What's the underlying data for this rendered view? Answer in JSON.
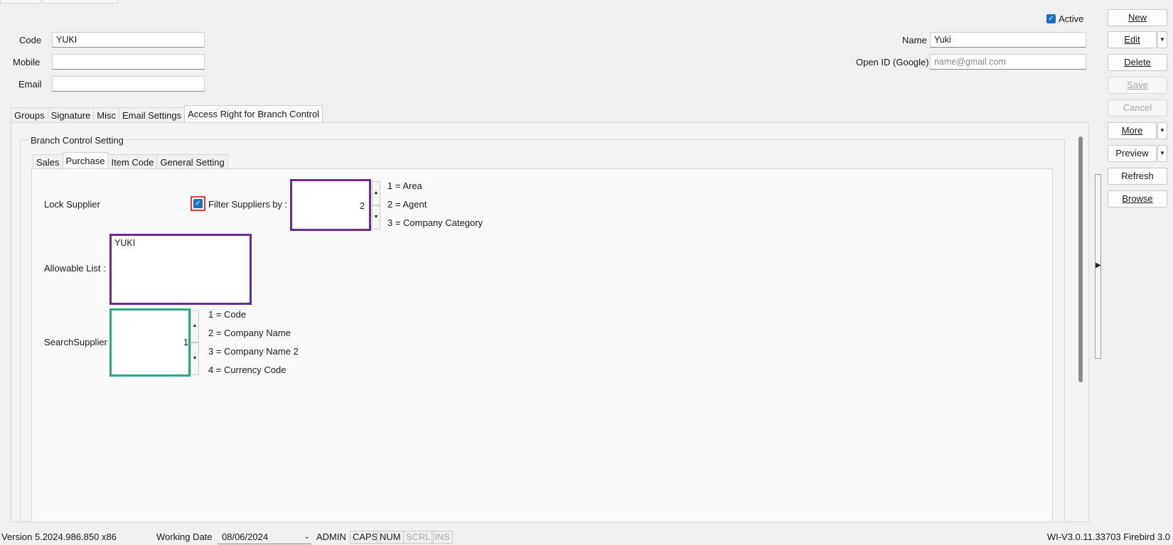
{
  "header": {
    "active_label": "Active",
    "code_label": "Code",
    "code_value": "YUKI",
    "mobile_label": "Mobile",
    "mobile_value": "",
    "email_label": "Email",
    "email_value": "",
    "name_label": "Name",
    "name_value": "Yuki",
    "openid_label": "Open ID (Google)",
    "openid_placeholder": "name@gmail.com"
  },
  "main_tabs": [
    "Groups",
    "Signature",
    "Misc",
    "Email Settings",
    "Access Right for Branch Control"
  ],
  "branch": {
    "group_title": "Branch Control Setting",
    "tabs": [
      "Sales",
      "Purchase",
      "Item Code",
      "General Setting"
    ],
    "lock_supplier_label": "Lock Supplier",
    "filter_label": "Filter Suppliers by :",
    "filter_value": "2",
    "filter_options": [
      "1 = Area",
      "2 = Agent",
      "3 = Company Category"
    ],
    "allowable_label": "Allowable List :",
    "allowable_value": "YUKI",
    "search_label": "SearchSupplier",
    "search_value": "1",
    "search_options": [
      "1 = Code",
      "2 = Company Name",
      "3 = Company Name 2",
      "4 = Currency Code"
    ]
  },
  "buttons": {
    "new": "New",
    "edit": "Edit",
    "delete": "Delete",
    "save": "Save",
    "cancel": "Cancel",
    "more": "More",
    "preview": "Preview",
    "refresh": "Refresh",
    "browse": "Browse"
  },
  "status_bar": {
    "version": "Version 5.2024.986.850 x86",
    "working_date_label": "Working Date",
    "working_date": "08/06/2024",
    "indicators": [
      "ADMIN",
      "CAPS",
      "NUM",
      "SCRL",
      "INS"
    ],
    "build": "WI-V3.0.11.33703 Firebird 3.0"
  },
  "colors": {
    "checkbox": "#1d6fc4",
    "highlight_red": "#e53935",
    "highlight_purple": "#6a2c91",
    "highlight_teal": "#2aa889"
  }
}
